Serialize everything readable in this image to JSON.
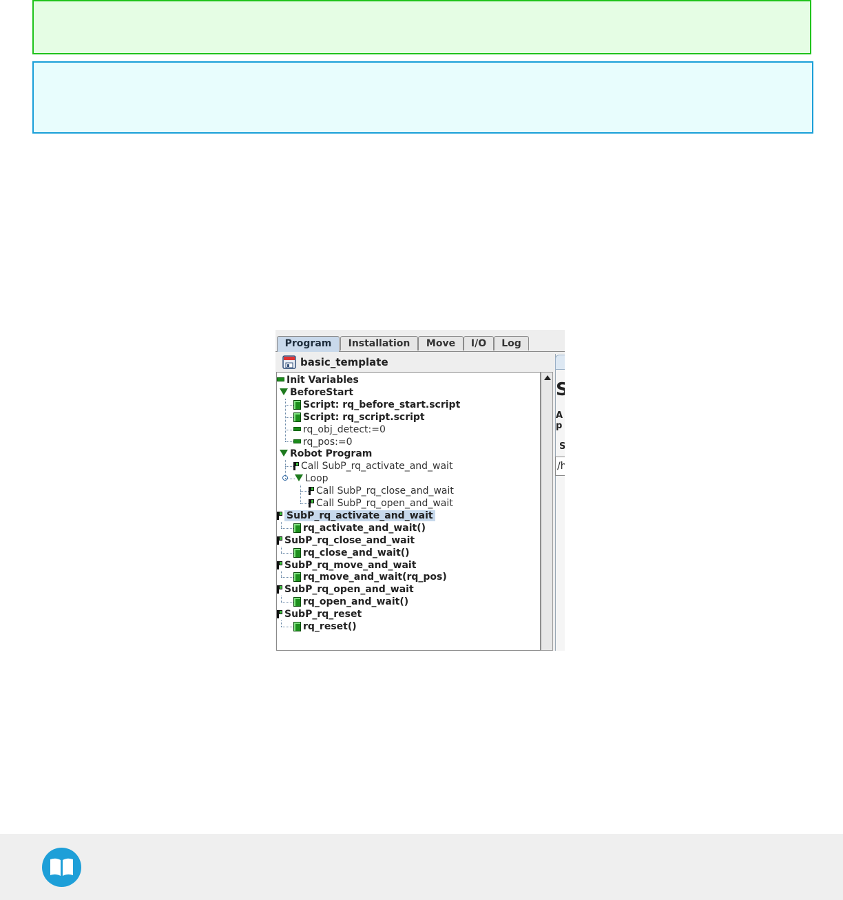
{
  "tabs": [
    "Program",
    "Installation",
    "Move",
    "I/O",
    "Log"
  ],
  "active_tab": "Program",
  "file": {
    "name": "basic_template",
    "icon": "save-file-icon"
  },
  "tree": [
    {
      "label": "Init Variables",
      "icon": "variable-icon",
      "style": "bold"
    },
    {
      "label": "BeforeStart",
      "icon": "collapse-triangle-icon",
      "style": "bold"
    },
    {
      "label": "Script: rq_before_start.script",
      "icon": "script-icon",
      "style": "bold"
    },
    {
      "label": "Script: rq_script.script",
      "icon": "script-icon",
      "style": "bold"
    },
    {
      "label": "rq_obj_detect:=0",
      "icon": "variable-icon",
      "style": "light"
    },
    {
      "label": "rq_pos:=0",
      "icon": "variable-icon",
      "style": "light"
    },
    {
      "label": "Robot Program",
      "icon": "collapse-triangle-icon",
      "style": "bold"
    },
    {
      "label": "Call SubP_rq_activate_and_wait",
      "icon": "call-flag-icon",
      "style": "light"
    },
    {
      "label": "Loop",
      "icon": "collapse-triangle-icon",
      "style": "light"
    },
    {
      "label": "Call SubP_rq_close_and_wait",
      "icon": "call-flag-icon",
      "style": "light"
    },
    {
      "label": "Call SubP_rq_open_and_wait",
      "icon": "call-flag-icon",
      "style": "light"
    },
    {
      "label": "SubP_rq_activate_and_wait",
      "icon": "subprogram-flag-icon",
      "style": "bold",
      "selected": true
    },
    {
      "label": "rq_activate_and_wait()",
      "icon": "script-icon",
      "style": "bold"
    },
    {
      "label": "SubP_rq_close_and_wait",
      "icon": "subprogram-flag-icon",
      "style": "bold"
    },
    {
      "label": "rq_close_and_wait()",
      "icon": "script-icon",
      "style": "bold"
    },
    {
      "label": "SubP_rq_move_and_wait",
      "icon": "subprogram-flag-icon",
      "style": "bold"
    },
    {
      "label": "rq_move_and_wait(rq_pos)",
      "icon": "script-icon",
      "style": "bold"
    },
    {
      "label": "SubP_rq_open_and_wait",
      "icon": "subprogram-flag-icon",
      "style": "bold"
    },
    {
      "label": "rq_open_and_wait()",
      "icon": "script-icon",
      "style": "bold"
    },
    {
      "label": "SubP_rq_reset",
      "icon": "subprogram-flag-icon",
      "style": "bold"
    },
    {
      "label": "rq_reset()",
      "icon": "script-icon",
      "style": "bold"
    }
  ],
  "right_pane": {
    "heading": "S",
    "line1": "A",
    "line2": "p",
    "field_label": "S",
    "field_value": "/h"
  },
  "colors": {
    "note_green": "#e5fde4",
    "note_blue": "#e8fdfd",
    "selection": "#c7d9ec"
  },
  "footer_icon": "book-icon"
}
